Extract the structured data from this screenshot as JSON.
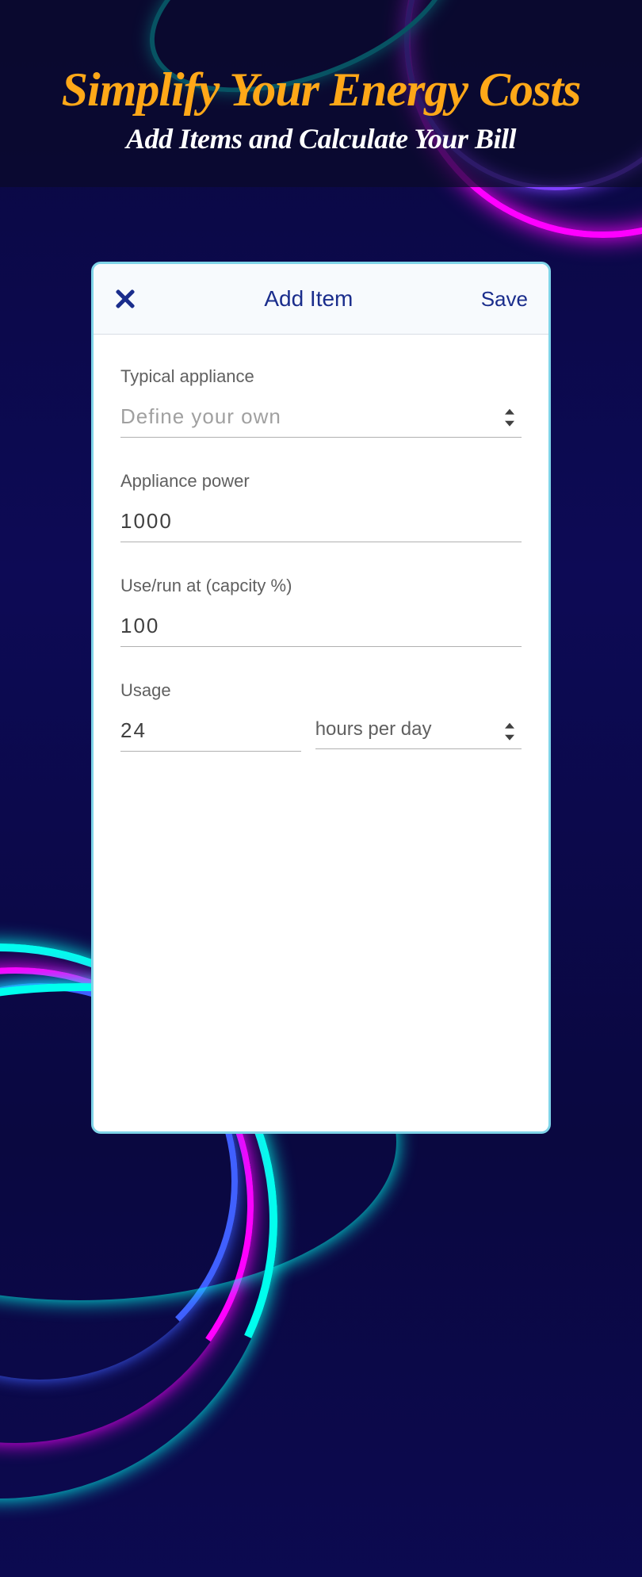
{
  "header": {
    "main_title": "Simplify Your Energy Costs",
    "sub_title": "Add Items and Calculate Your Bill"
  },
  "card": {
    "title": "Add Item",
    "save_label": "Save"
  },
  "form": {
    "appliance_label": "Typical appliance",
    "appliance_value": "Define your own",
    "power_label": "Appliance power",
    "power_value": "1000",
    "capacity_label": "Use/run at (capcity %)",
    "capacity_value": "100",
    "usage_label": "Usage",
    "usage_value": "24",
    "usage_unit": "hours per day"
  }
}
